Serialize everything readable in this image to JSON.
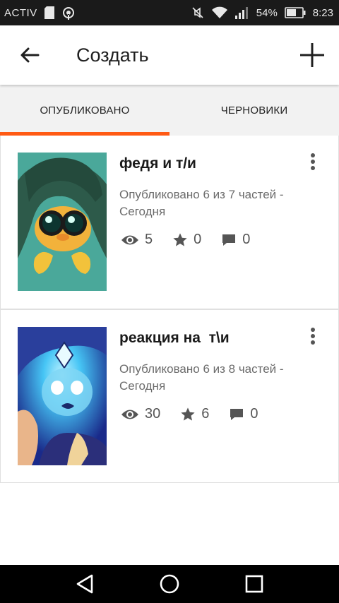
{
  "status_bar": {
    "carrier": "ACTIV",
    "battery": "54%",
    "time": "8:23"
  },
  "app_bar": {
    "title": "Создать"
  },
  "tabs": [
    {
      "label": "ОПУБЛИКОВАНО",
      "active": true
    },
    {
      "label": "ЧЕРНОВИКИ",
      "active": false
    }
  ],
  "stories": [
    {
      "title": "федя и т/и",
      "meta": "Опубликовано 6 из 7 частей - Сегодня",
      "views": "5",
      "votes": "0",
      "comments": "0"
    },
    {
      "title": "реакция на  т\\и",
      "meta": "Опубликовано 6 из 8 частей - Сегодня",
      "views": "30",
      "votes": "6",
      "comments": "0"
    }
  ],
  "colors": {
    "accent": "#ff5a14",
    "status_bar": "#1a1a1a",
    "nav_bar": "#000000",
    "tab_bg": "#f2f2f2"
  },
  "icons": {
    "status": [
      "sd-card-icon",
      "hotspot-icon",
      "mute-icon",
      "wifi-icon",
      "signal-icon",
      "battery-icon"
    ],
    "app_bar": [
      "back-arrow-icon",
      "plus-icon"
    ],
    "story": [
      "eye-icon",
      "star-icon",
      "comment-icon",
      "more-vert-icon"
    ],
    "nav": [
      "back-triangle-icon",
      "home-circle-icon",
      "recents-square-icon"
    ]
  }
}
